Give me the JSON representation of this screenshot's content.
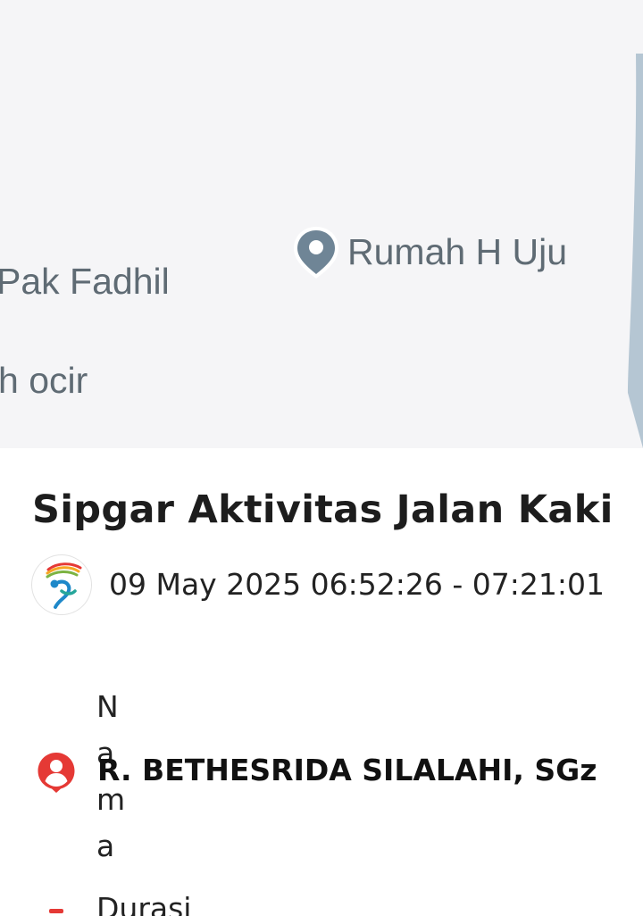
{
  "map": {
    "places": {
      "pak_fadhil": "Pak Fadhil",
      "h_ocir": "h ocir",
      "rumah_h_uju": "Rumah H Uju"
    },
    "pin_icon": "location-pin-icon",
    "colors": {
      "background": "#f5f5f7",
      "label": "#5f6b74",
      "pin": "#6f8596",
      "edge": "#b5c6d3"
    }
  },
  "activity": {
    "title": "Sipgar Aktivitas Jalan Kaki",
    "datetime": "09 May 2025 06:52:26 - 07:21:01",
    "logo_icon": "sipgar-runner-logo"
  },
  "details": {
    "name_label": "Nama",
    "name_value": "R. BETHESRIDA SILALAHI, SGz",
    "name_icon": "person-circle-icon",
    "duration_label": "Durasi",
    "accent_color": "#e53935"
  }
}
